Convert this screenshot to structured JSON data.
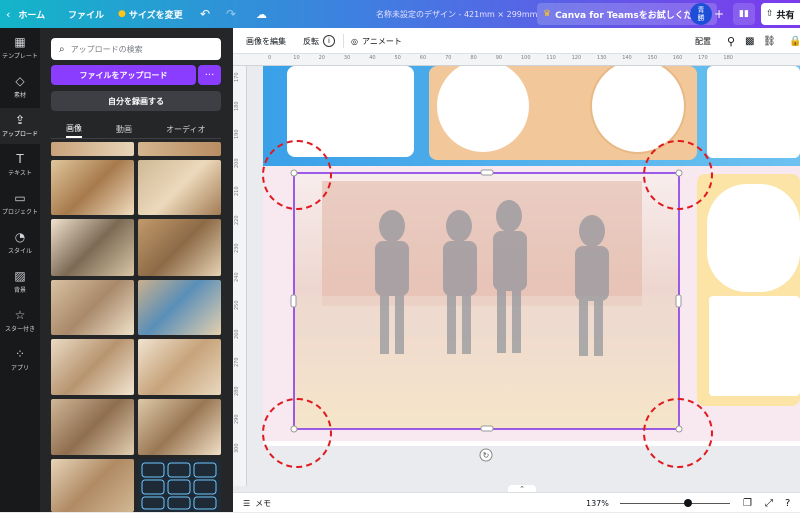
{
  "topbar": {
    "home": "ホーム",
    "file": "ファイル",
    "resize": "サイズを変更",
    "title": "名称未設定のデザイン - 421mm × 299mm",
    "teams": "Canva for Teamsをお試しください",
    "avatar": "青\n勝",
    "share": "共有"
  },
  "rail": [
    {
      "label": "テンプレート",
      "icon": "▦"
    },
    {
      "label": "素材",
      "icon": "◇"
    },
    {
      "label": "アップロード",
      "icon": "⇪"
    },
    {
      "label": "テキスト",
      "icon": "T"
    },
    {
      "label": "プロジェクト",
      "icon": "▭"
    },
    {
      "label": "スタイル",
      "icon": "◔"
    },
    {
      "label": "背景",
      "icon": "▨"
    },
    {
      "label": "スター付き",
      "icon": "☆"
    },
    {
      "label": "アプリ",
      "icon": "⁘"
    }
  ],
  "panel": {
    "search_placeholder": "アップロードの検索",
    "upload_button": "ファイルをアップロード",
    "more": "···",
    "record_button": "自分を録画する",
    "tabs": [
      "画像",
      "動画",
      "オーディオ"
    ]
  },
  "toolbar": {
    "edit_image": "画像を編集",
    "flip": "反転",
    "info": "i",
    "animate": "アニメート",
    "position": "配置"
  },
  "ruler": {
    "top": [
      "0",
      "10",
      "20",
      "30",
      "40",
      "50",
      "60",
      "70",
      "80",
      "90",
      "100",
      "110",
      "120",
      "130",
      "140",
      "150",
      "160",
      "170",
      "180"
    ],
    "left": [
      "170",
      "180",
      "190",
      "200",
      "210",
      "220",
      "230",
      "240",
      "250",
      "260",
      "270",
      "280",
      "290",
      "300"
    ]
  },
  "bottom": {
    "notes": "メモ",
    "zoom": "137%",
    "zoom_fraction": 0.62
  },
  "colors": {
    "accent": "#8b3dff",
    "selection": "#7d2ae8",
    "annotation": "#e0191e"
  }
}
